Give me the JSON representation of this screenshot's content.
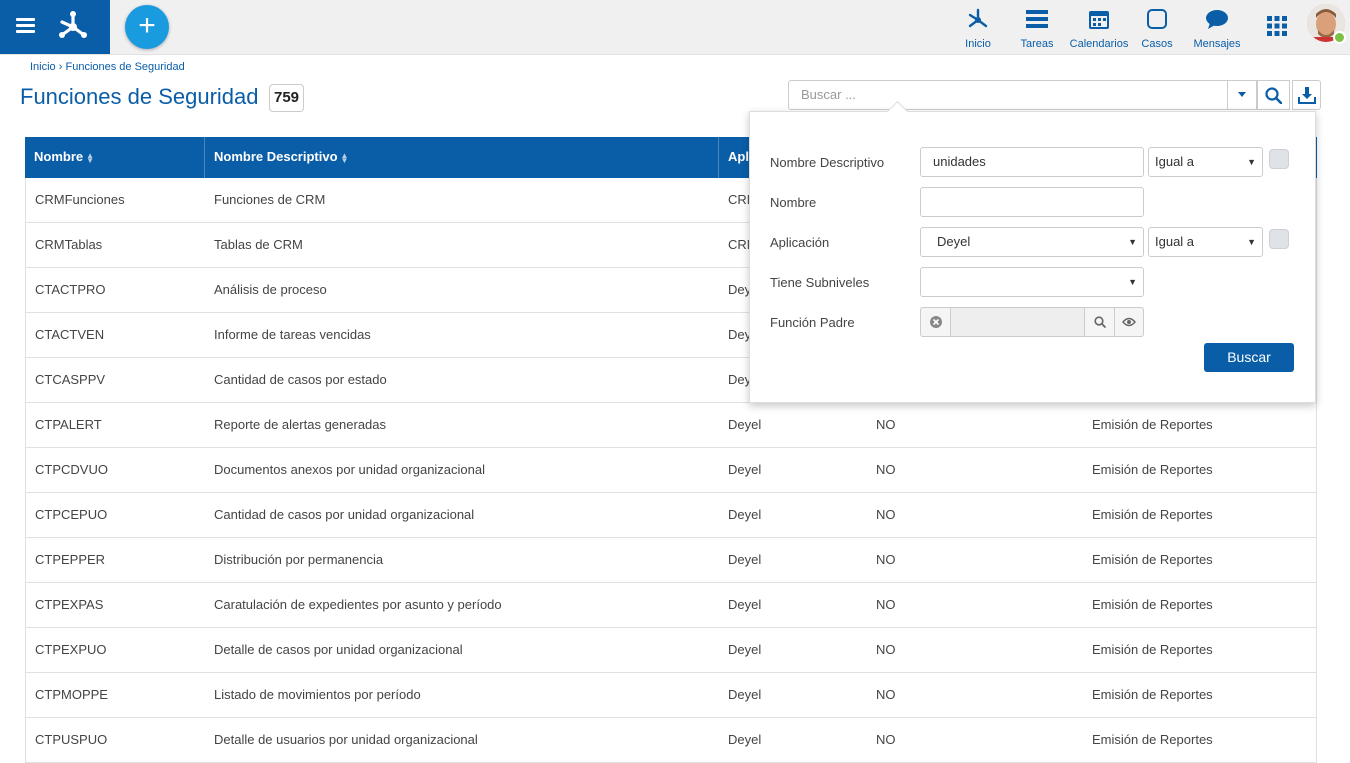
{
  "nav": {
    "items": [
      {
        "label": "Inicio",
        "icon": "process-icon"
      },
      {
        "label": "Tareas",
        "icon": "tasks-icon"
      },
      {
        "label": "Calendarios",
        "icon": "calendar-icon"
      },
      {
        "label": "Casos",
        "icon": "cases-icon"
      },
      {
        "label": "Mensajes",
        "icon": "messages-icon"
      }
    ],
    "add_button": "+"
  },
  "breadcrumb": {
    "home": "Inicio",
    "separator": "›",
    "current": "Funciones de Seguridad"
  },
  "page": {
    "title": "Funciones de Seguridad",
    "count": "759"
  },
  "search": {
    "placeholder": "Buscar ..."
  },
  "table": {
    "headers": [
      "Nombre",
      "Nombre Descriptivo",
      "Apli"
    ],
    "rows": [
      [
        "CRMFunciones",
        "Funciones de CRM",
        "CRM",
        "",
        ""
      ],
      [
        "CRMTablas",
        "Tablas de CRM",
        "CRM",
        "",
        ""
      ],
      [
        "CTACTPRO",
        "Análisis de proceso",
        "Deyel",
        "",
        ""
      ],
      [
        "CTACTVEN",
        "Informe de tareas vencidas",
        "Deyel",
        "",
        ""
      ],
      [
        "CTCASPPV",
        "Cantidad de casos por estado",
        "Deyel",
        "",
        ""
      ],
      [
        "CTPALERT",
        "Reporte de alertas generadas",
        "Deyel",
        "NO",
        "Emisión de Reportes"
      ],
      [
        "CTPCDVUO",
        "Documentos anexos por unidad organizacional",
        "Deyel",
        "NO",
        "Emisión de Reportes"
      ],
      [
        "CTPCEPUO",
        "Cantidad de casos por unidad organizacional",
        "Deyel",
        "NO",
        "Emisión de Reportes"
      ],
      [
        "CTPEPPER",
        "Distribución por permanencia",
        "Deyel",
        "NO",
        "Emisión de Reportes"
      ],
      [
        "CTPEXPAS",
        "Caratulación de expedientes por asunto y período",
        "Deyel",
        "NO",
        "Emisión de Reportes"
      ],
      [
        "CTPEXPUO",
        "Detalle de casos por unidad organizacional",
        "Deyel",
        "NO",
        "Emisión de Reportes"
      ],
      [
        "CTPMOPPE",
        "Listado de movimientos por período",
        "Deyel",
        "NO",
        "Emisión de Reportes"
      ],
      [
        "CTPUSPUO",
        "Detalle de usuarios por unidad organizacional",
        "Deyel",
        "NO",
        "Emisión de Reportes"
      ]
    ]
  },
  "filter": {
    "nombre_descriptivo": {
      "label": "Nombre Descriptivo",
      "value": "unidades",
      "operator": "Igual a"
    },
    "nombre": {
      "label": "Nombre",
      "value": ""
    },
    "aplicacion": {
      "label": "Aplicación",
      "value": "Deyel",
      "operator": "Igual a"
    },
    "tiene_subniveles": {
      "label": "Tiene Subniveles",
      "value": ""
    },
    "funcion_padre": {
      "label": "Función Padre",
      "value": ""
    },
    "submit": "Buscar"
  },
  "colors": {
    "primary": "#0a5ea8",
    "accent": "#1a9be0",
    "online": "#7cc142"
  }
}
